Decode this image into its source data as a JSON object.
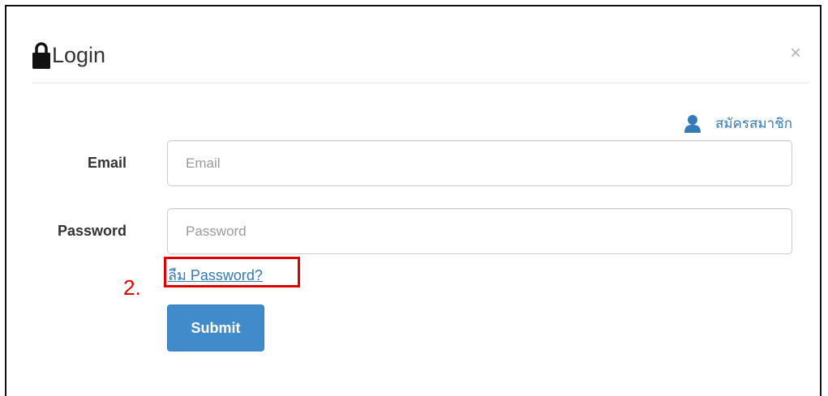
{
  "modal": {
    "title": "Login",
    "close_symbol": "×",
    "title_icon": "lock-icon"
  },
  "register": {
    "label": "สมัครสมาชิก",
    "icon": "user-icon"
  },
  "email": {
    "label": "Email",
    "placeholder": "Email",
    "value": ""
  },
  "password": {
    "label": "Password",
    "placeholder": "Password",
    "value": ""
  },
  "forgot_password": {
    "label": "ลืม Password?"
  },
  "annotation": {
    "number": "2.",
    "color": "#e00000"
  },
  "submit": {
    "label": "Submit",
    "color": "#428bca"
  },
  "colors": {
    "link": "#337ab7",
    "text": "#333333",
    "placeholder": "#999999"
  }
}
